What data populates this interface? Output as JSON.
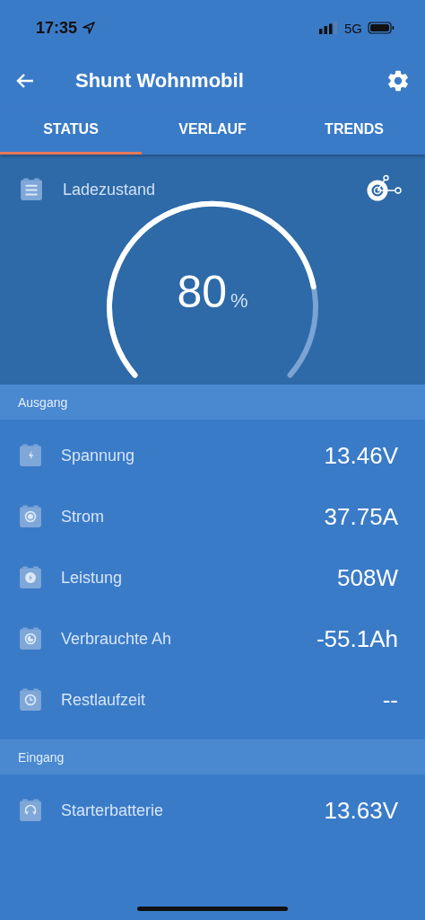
{
  "status_bar": {
    "time": "17:35",
    "network": "5G"
  },
  "app_bar": {
    "title": "Shunt Wohnmobil"
  },
  "tabs": [
    {
      "label": "STATUS",
      "selected": true
    },
    {
      "label": "VERLAUF",
      "selected": false
    },
    {
      "label": "TRENDS",
      "selected": false
    }
  ],
  "gauge": {
    "label": "Ladezustand",
    "value": "80",
    "unit": "%"
  },
  "sections": [
    {
      "title": "Ausgang",
      "rows": [
        {
          "kind": "voltage",
          "label": "Spannung",
          "value": "13.46V"
        },
        {
          "kind": "current",
          "label": "Strom",
          "value": "37.75A"
        },
        {
          "kind": "power",
          "label": "Leistung",
          "value": "508W"
        },
        {
          "kind": "consumed",
          "label": "Verbrauchte Ah",
          "value": "-55.1Ah"
        },
        {
          "kind": "time",
          "label": "Restlaufzeit",
          "value": "--"
        }
      ]
    },
    {
      "title": "Eingang",
      "rows": [
        {
          "kind": "starter",
          "label": "Starterbatterie",
          "value": "13.63V"
        }
      ]
    }
  ]
}
